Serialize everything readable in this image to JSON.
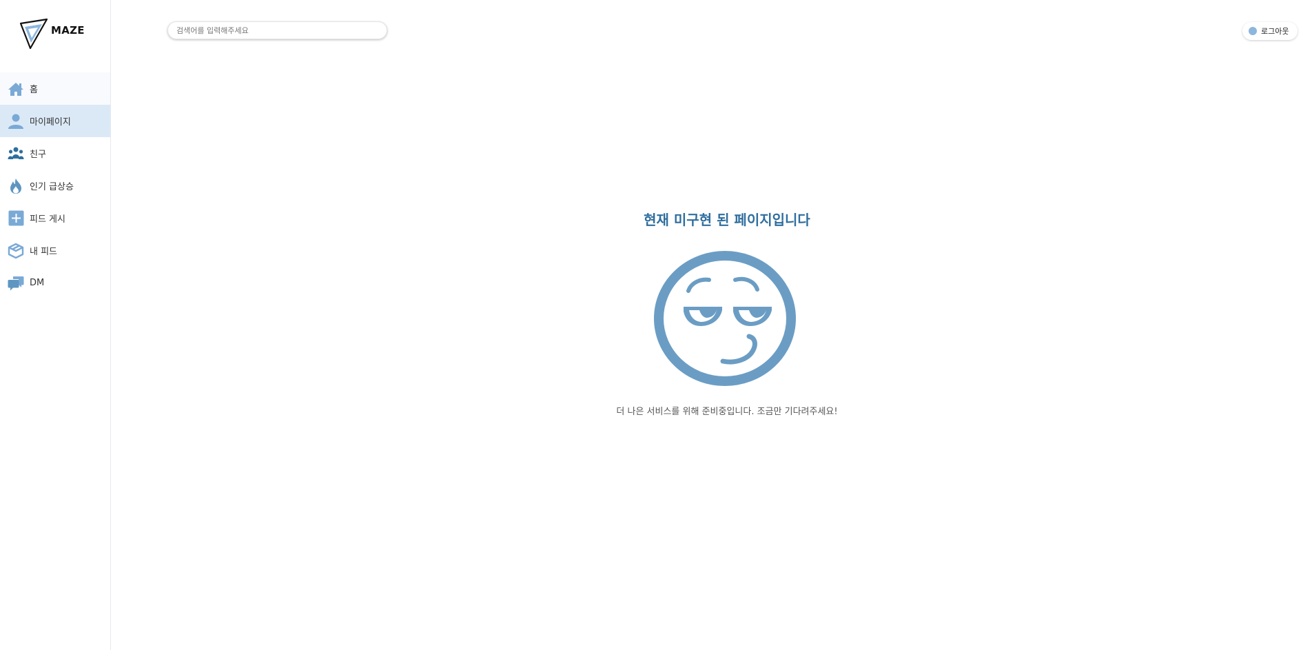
{
  "app": {
    "logo_text": "MAZE"
  },
  "search": {
    "placeholder": "검색어를 입력해주세요"
  },
  "header": {
    "logout_label": "로그아웃"
  },
  "sidebar": {
    "items": [
      {
        "label": "홈",
        "icon": "home-icon"
      },
      {
        "label": "마이페이지",
        "icon": "user-icon",
        "active": true
      },
      {
        "label": "친구",
        "icon": "friends-icon"
      },
      {
        "label": "인기 급상승",
        "icon": "fire-icon"
      },
      {
        "label": "피드 게시",
        "icon": "plus-square-icon"
      },
      {
        "label": "내 피드",
        "icon": "box-icon"
      },
      {
        "label": "DM",
        "icon": "chat-icon"
      }
    ]
  },
  "main": {
    "title": "현재 미구현 된 페이지입니다",
    "description": "더 나은 서비스를 위해 준비중입니다. 조금만 기다려주세요!",
    "illustration": "smirk-face-icon"
  },
  "colors": {
    "accent": "#5e96c2",
    "title": "#2f6e9e",
    "active_bg": "#dbe9f7",
    "icon_light": "#8db6dd"
  }
}
